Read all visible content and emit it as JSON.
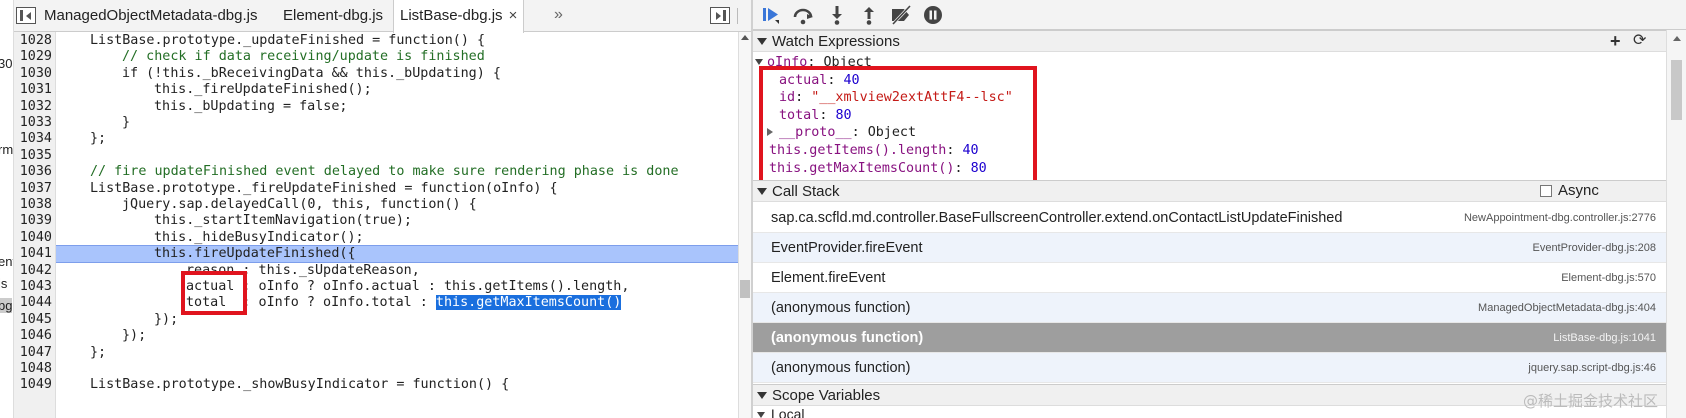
{
  "left_strip": {
    "fragments": [
      "30",
      "rm",
      "ent",
      "js",
      "bg"
    ]
  },
  "source": {
    "tabs": [
      {
        "label": "ManagedObjectMetadata-dbg.js"
      },
      {
        "label": "Element-dbg.js"
      },
      {
        "label": "ListBase-dbg.js"
      }
    ],
    "tab_close_glyph": "×",
    "tab_more_glyph": "»",
    "line_numbers": [
      "1028",
      "1029",
      "1030",
      "1031",
      "1032",
      "1033",
      "1034",
      "1035",
      "1036",
      "1037",
      "1038",
      "1039",
      "1040",
      "1041",
      "1042",
      "1043",
      "1044",
      "1045",
      "1046",
      "1047",
      "1048",
      "1049"
    ],
    "execution_line": "1041",
    "code": {
      "l1028": "ListBase.prototype._updateFinished = function() {",
      "l1029": "// check if data receiving/update is finished",
      "l1030": "if (!this._bReceivingData && this._bUpdating) {",
      "l1031": "this._fireUpdateFinished();",
      "l1032": "this._bUpdating = false;",
      "l1033": "}",
      "l1034": "};",
      "l1036": "// fire updateFinished event delayed to make sure rendering phase is done",
      "l1037": "ListBase.prototype._fireUpdateFinished = function(oInfo) {",
      "l1038": "jQuery.sap.delayedCall(0, this, function() {",
      "l1039": "this._startItemNavigation(true);",
      "l1040": "this._hideBusyIndicator();",
      "l1041": "this.fireUpdateFinished({",
      "l1042": "reason : this._sUpdateReason,",
      "l1043_key": "actual",
      "l1043_rest": " : oInfo ? oInfo.actual : this.getItems().length,",
      "l1044_key": "total",
      "l1044_mid": "  : oInfo ? oInfo.total : ",
      "l1044_sel": "this.getMaxItemsCount()",
      "l1045": "});",
      "l1046": "});",
      "l1047": "};",
      "l1049": "ListBase.prototype._showBusyIndicator = function() {"
    }
  },
  "debugger": {
    "toolbar": {
      "buttons": [
        "resume-icon",
        "step-over-icon",
        "step-into-icon",
        "step-out-icon",
        "deactivate-breakpoints-icon",
        "pause-on-exceptions-icon"
      ]
    },
    "watch": {
      "title": "Watch Expressions",
      "add_glyph": "+",
      "refresh_glyph": "⟳",
      "root_name": "oInfo",
      "root_type": "Object",
      "props": [
        {
          "key": "actual",
          "value": "40",
          "kind": "num"
        },
        {
          "key": "id",
          "value": "\"__xmlview2extAttF4--lsc\"",
          "kind": "str"
        },
        {
          "key": "total",
          "value": "80",
          "kind": "num"
        }
      ],
      "proto_key": "__proto__",
      "proto_value": "Object",
      "expressions": [
        {
          "expr": "this.getItems().length",
          "value": "40"
        },
        {
          "expr": "this.getMaxItemsCount()",
          "value": "80"
        }
      ]
    },
    "call_stack": {
      "title": "Call Stack",
      "async_label": "Async",
      "frames": [
        {
          "fn": "sap.ca.scfld.md.controller.BaseFullscreenController.extend.onContactListUpdateFinished",
          "loc": "NewAppointment-dbg.controller.js:2776"
        },
        {
          "fn": "EventProvider.fireEvent",
          "loc": "EventProvider-dbg.js:208"
        },
        {
          "fn": "Element.fireEvent",
          "loc": "Element-dbg.js:570"
        },
        {
          "fn": "(anonymous function)",
          "loc": "ManagedObjectMetadata-dbg.js:404"
        },
        {
          "fn": "(anonymous function)",
          "loc": "ListBase-dbg.js:1041"
        },
        {
          "fn": "(anonymous function)",
          "loc": "jquery.sap.script-dbg.js:46"
        }
      ]
    },
    "scope": {
      "title": "Scope Variables",
      "next_label": "Local"
    }
  },
  "watermark": "@稀土掘金技术社区"
}
